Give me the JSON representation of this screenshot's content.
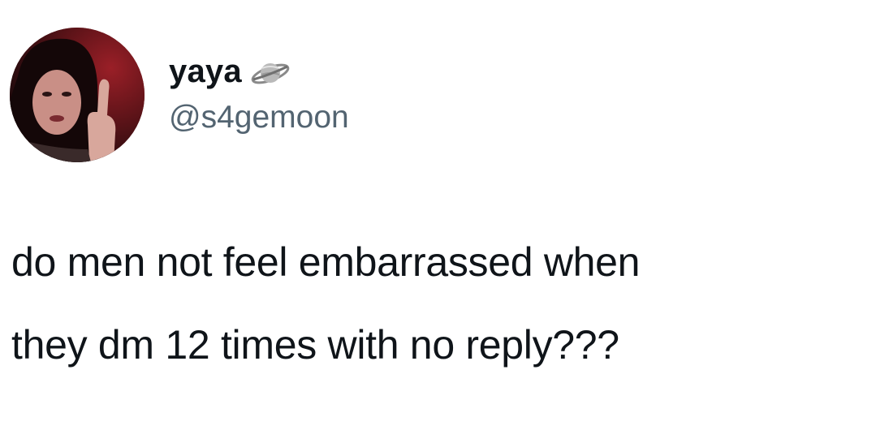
{
  "author": {
    "display_name": "yaya",
    "handle": "@s4gemoon",
    "name_emoji_icon": "ringed-planet-icon",
    "avatar_icon": "profile-photo"
  },
  "tweet": {
    "line1": "do men not feel embarrassed when",
    "line2": "they dm 12 times with no reply???"
  },
  "colors": {
    "text_primary": "#0f1419",
    "text_secondary": "#536471",
    "background": "#ffffff"
  }
}
